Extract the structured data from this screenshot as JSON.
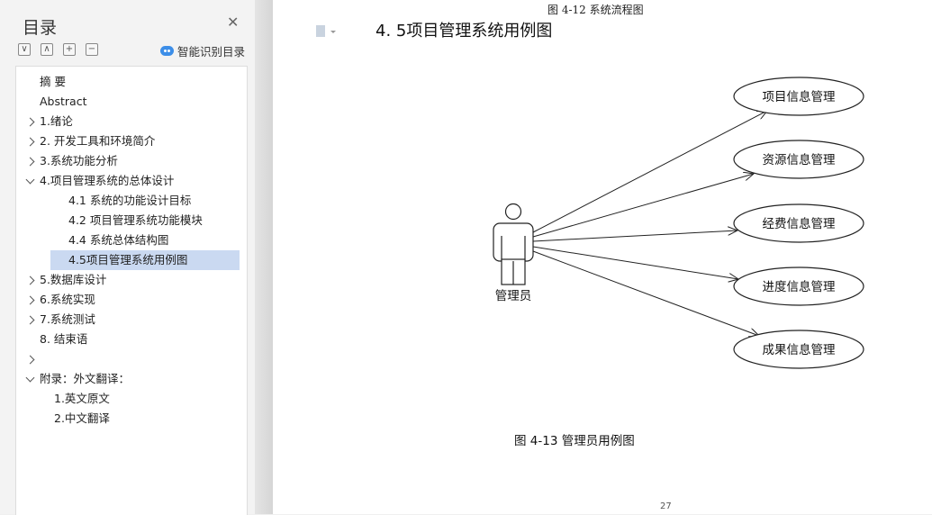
{
  "sidebar": {
    "title": "目录",
    "smart_toc_label": "智能识别目录",
    "tools": [
      "∨",
      "∧",
      "+",
      "−"
    ],
    "items": [
      {
        "label": "摘    要",
        "chevron": "none"
      },
      {
        "label": "Abstract",
        "chevron": "none"
      },
      {
        "label": "1.绪论",
        "chevron": "right"
      },
      {
        "label": "2. 开发工具和环境简介",
        "chevron": "right"
      },
      {
        "label": "3.系统功能分析",
        "chevron": "right"
      },
      {
        "label": "4.项目管理系统的总体设计",
        "chevron": "down"
      },
      {
        "label": "4.1  系统的功能设计目标",
        "chevron": "none"
      },
      {
        "label": "4.2  项目管理系统功能模块",
        "chevron": "none"
      },
      {
        "label": "4.4  系统总体结构图",
        "chevron": "none"
      },
      {
        "label": "4.5项目管理系统用例图",
        "chevron": "none",
        "selected": true
      },
      {
        "label": "5.数据库设计",
        "chevron": "right"
      },
      {
        "label": "6.系统实现",
        "chevron": "right"
      },
      {
        "label": "7.系统测试",
        "chevron": "right"
      },
      {
        "label": "8.  结束语",
        "chevron": "none"
      },
      {
        "label": "",
        "chevron": "right"
      },
      {
        "label": "附录：外文翻译：",
        "chevron": "down"
      },
      {
        "label": "1.英文原文",
        "chevron": "none"
      },
      {
        "label": "2.中文翻译",
        "chevron": "none"
      }
    ]
  },
  "document": {
    "prev_caption": "图 4-12 系统流程图",
    "heading": "4. 5项目管理系统用例图",
    "actor": "管理员",
    "use_cases": [
      "项目信息管理",
      "资源信息管理",
      "经费信息管理",
      "进度信息管理",
      "成果信息管理"
    ],
    "figure_caption": "图 4-13 管理员用例图",
    "page_number": "27"
  },
  "colors": {
    "selected": "#cad9f1",
    "smart_icon": "#3c8ee8"
  }
}
